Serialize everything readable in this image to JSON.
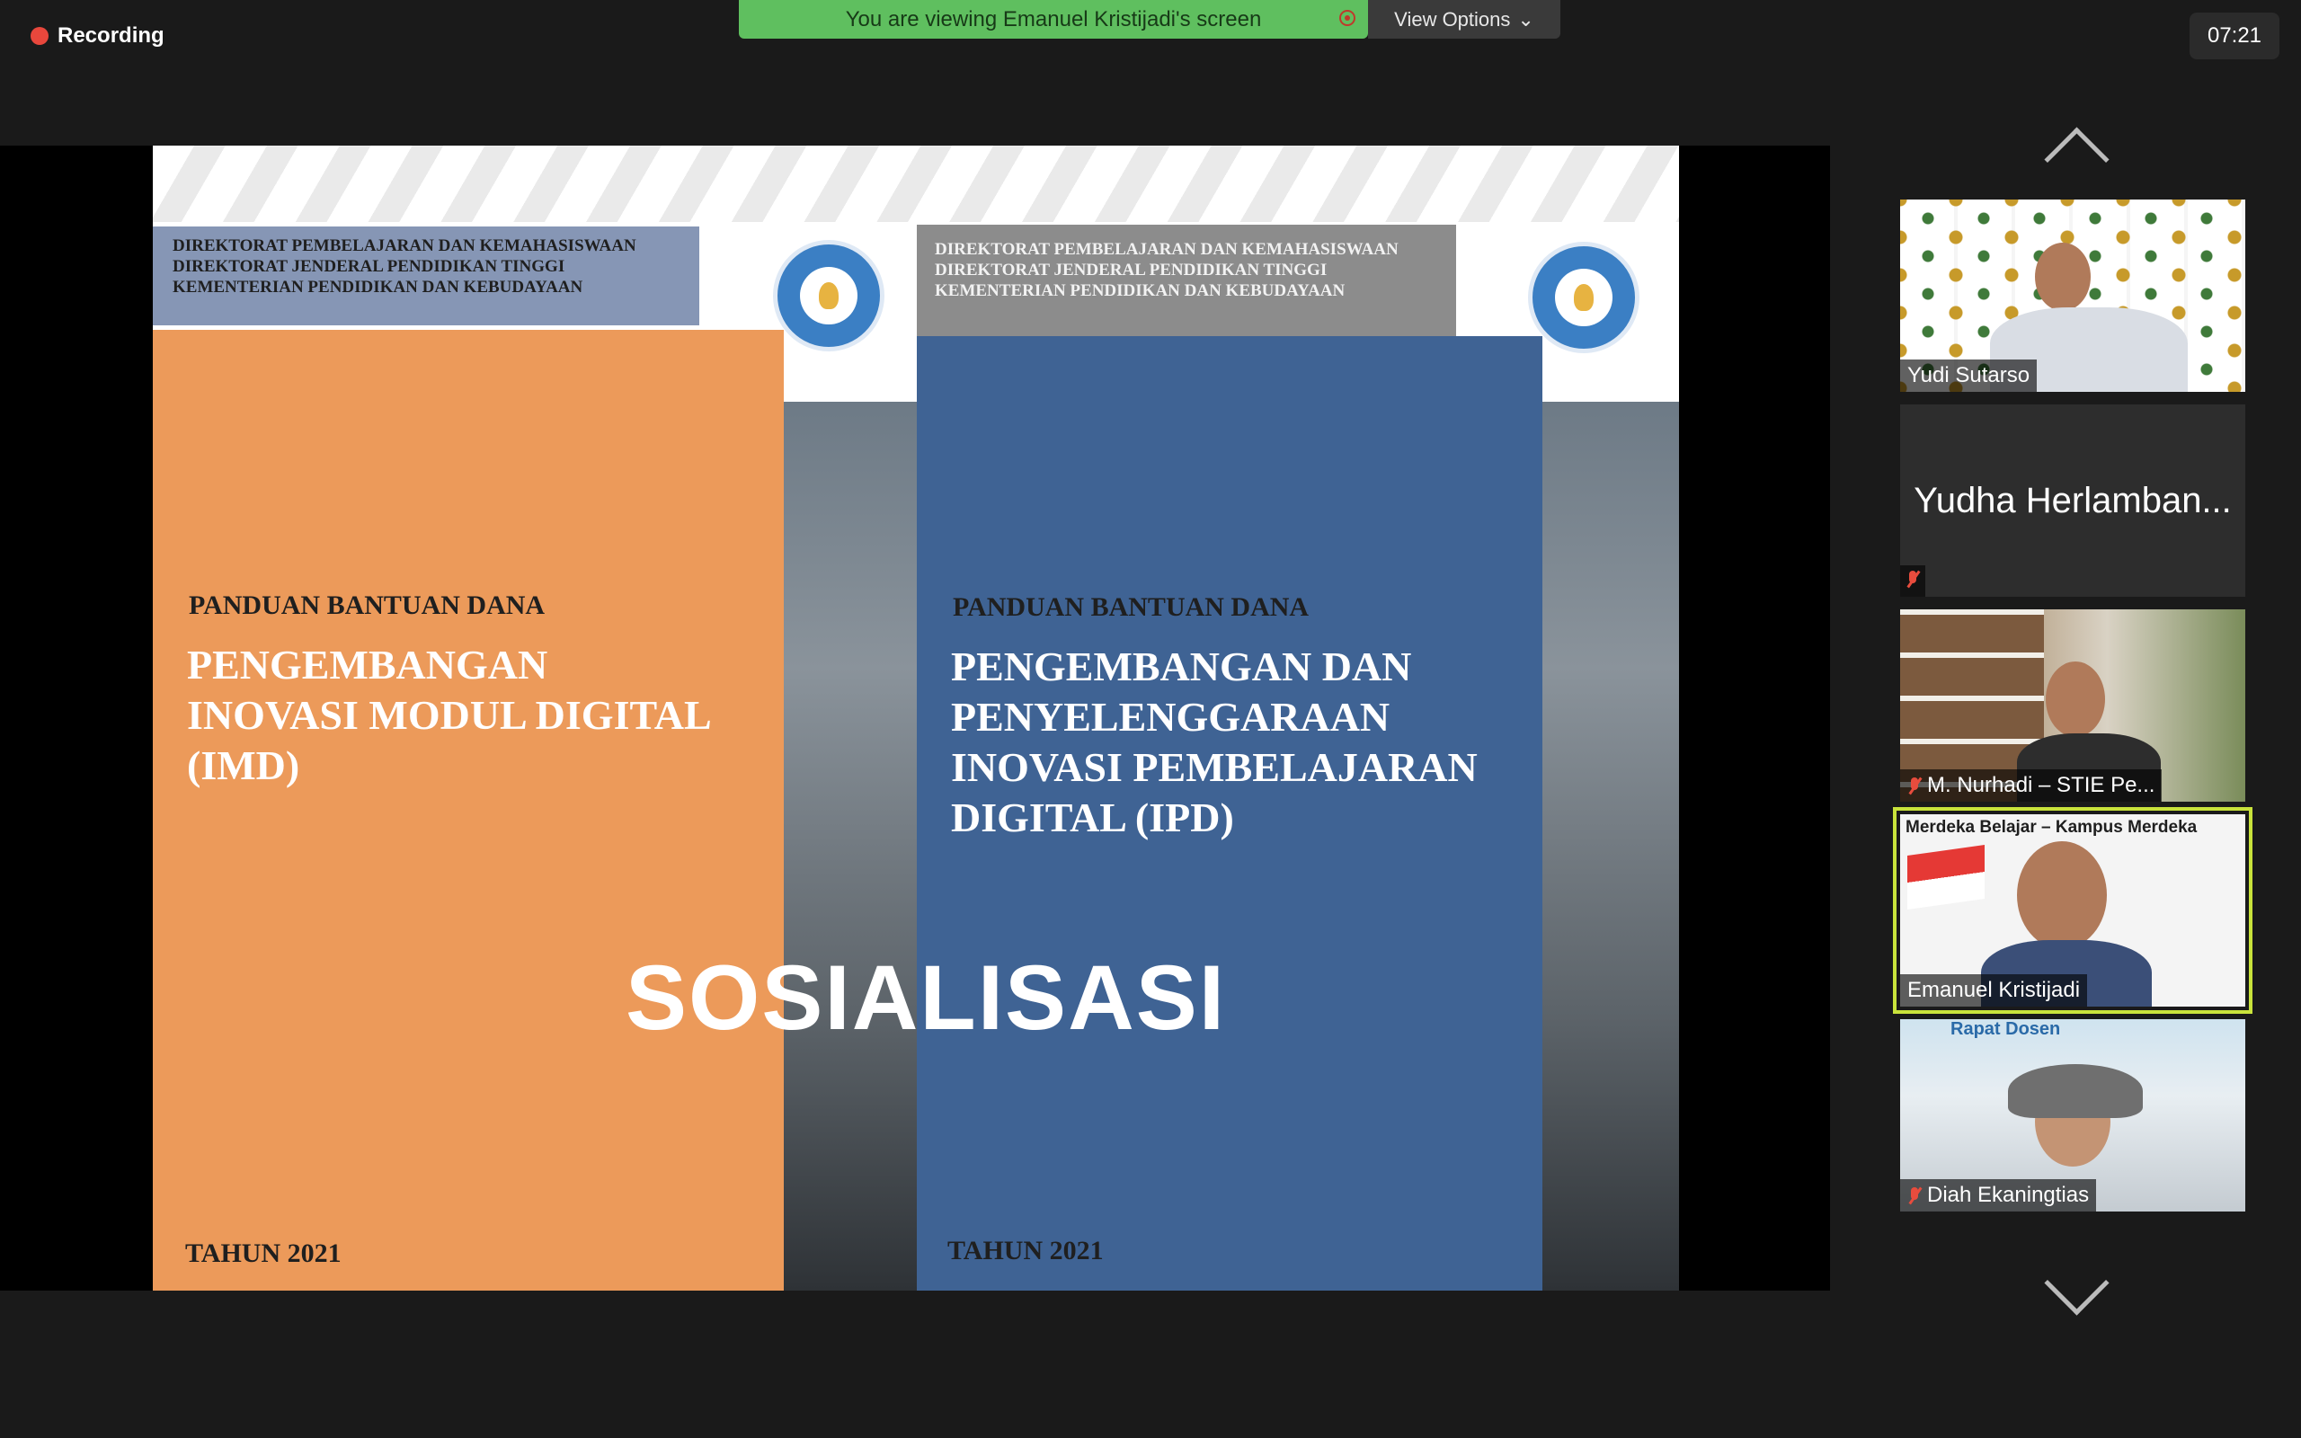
{
  "recording": {
    "label": "Recording"
  },
  "share_banner": {
    "text": "You are viewing Emanuel Kristijadi's screen",
    "view_options": "View Options"
  },
  "clock": "07:21",
  "slide": {
    "left": {
      "directorate": [
        "DIREKTORAT PEMBELAJARAN DAN KEMAHASISWAAN",
        "DIREKTORAT JENDERAL PENDIDIKAN TINGGI",
        "KEMENTERIAN PENDIDIKAN DAN KEBUDAYAAN"
      ],
      "panduan": "PANDUAN BANTUAN DANA",
      "title": [
        "PENGEMBANGAN",
        "INOVASI MODUL DIGITAL",
        "(IMD)"
      ],
      "tahun": "TAHUN 2021"
    },
    "right": {
      "directorate": [
        "DIREKTORAT PEMBELAJARAN DAN KEMAHASISWAAN",
        "DIREKTORAT JENDERAL PENDIDIKAN TINGGI",
        "KEMENTERIAN PENDIDIKAN DAN KEBUDAYAAN"
      ],
      "panduan": "PANDUAN BANTUAN DANA",
      "title": [
        "PENGEMBANGAN DAN",
        "PENYELENGGARAAN",
        "INOVASI PEMBELAJARAN",
        "DIGITAL (IPD)"
      ],
      "tahun": "TAHUN 2021"
    },
    "overlay": "SOSIALISASI"
  },
  "participants": [
    {
      "name": "Yudi Sutarso",
      "muted": false
    },
    {
      "name": "Yudha Herlamban...",
      "muted": true
    },
    {
      "name": "M. Nurhadi – STIE Pe...",
      "muted": true
    },
    {
      "name": "Emanuel Kristijadi",
      "muted": false,
      "active_speaker": true,
      "background_text": "Merdeka Belajar – Kampus Merdeka"
    },
    {
      "name": "Diah Ekaningtias",
      "muted": true,
      "background_text": "Rapat Dosen"
    }
  ],
  "colors": {
    "banner_green": "#5fbf5f",
    "recording_red": "#e8473c",
    "active_speaker_border": "#c9e33b",
    "slide_orange": "#ec9a5a",
    "slide_blue": "#3f6394"
  }
}
